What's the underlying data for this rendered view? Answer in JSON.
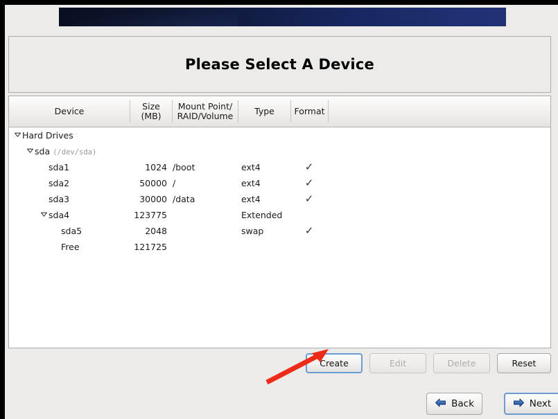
{
  "window": {
    "banner_gradient_from": "#0a0f22",
    "banner_gradient_to": "#203275",
    "background": "#ECEBE9"
  },
  "header": {
    "title": "Please Select A Device"
  },
  "device_table": {
    "columns": [
      {
        "label": "Device",
        "sublabel": ""
      },
      {
        "label": "Size",
        "sublabel": "(MB)"
      },
      {
        "label": "Mount Point/",
        "sublabel": "RAID/Volume"
      },
      {
        "label": "Type",
        "sublabel": ""
      },
      {
        "label": "Format",
        "sublabel": ""
      }
    ],
    "rows": [
      {
        "indent": 0,
        "twisty": "expanded",
        "device": "Hard Drives",
        "device_sub": "",
        "size": "",
        "mount": "",
        "type": "",
        "format": false
      },
      {
        "indent": 1,
        "twisty": "expanded",
        "device": "sda",
        "device_sub": "(/dev/sda)",
        "size": "",
        "mount": "",
        "type": "",
        "format": false
      },
      {
        "indent": 2,
        "twisty": "none",
        "device": "sda1",
        "device_sub": "",
        "size": "1024",
        "mount": "/boot",
        "type": "ext4",
        "format": true
      },
      {
        "indent": 2,
        "twisty": "none",
        "device": "sda2",
        "device_sub": "",
        "size": "50000",
        "mount": "/",
        "type": "ext4",
        "format": true
      },
      {
        "indent": 2,
        "twisty": "none",
        "device": "sda3",
        "device_sub": "",
        "size": "30000",
        "mount": "/data",
        "type": "ext4",
        "format": true
      },
      {
        "indent": 2,
        "twisty": "expanded",
        "device": "sda4",
        "device_sub": "",
        "size": "123775",
        "mount": "",
        "type": "Extended",
        "format": false
      },
      {
        "indent": 3,
        "twisty": "none",
        "device": "sda5",
        "device_sub": "",
        "size": "2048",
        "mount": "",
        "type": "swap",
        "format": true
      },
      {
        "indent": 3,
        "twisty": "none",
        "device": "Free",
        "device_sub": "",
        "size": "121725",
        "mount": "",
        "type": "",
        "format": false
      }
    ],
    "check_glyph": "✓",
    "check_color": "#2A3348"
  },
  "actions": {
    "create": {
      "label": "Create",
      "state": "focused"
    },
    "edit": {
      "label": "Edit",
      "state": "disabled"
    },
    "delete": {
      "label": "Delete",
      "state": "disabled"
    },
    "reset": {
      "label": "Reset",
      "state": "enabled"
    }
  },
  "navigation": {
    "back": {
      "label": "Back",
      "icon": "arrow-left-icon"
    },
    "next": {
      "label": "Next",
      "icon": "arrow-right-icon",
      "state": "focused"
    }
  },
  "annotation": {
    "arrow_color": "#ED2B19",
    "points_to": "create-button"
  }
}
